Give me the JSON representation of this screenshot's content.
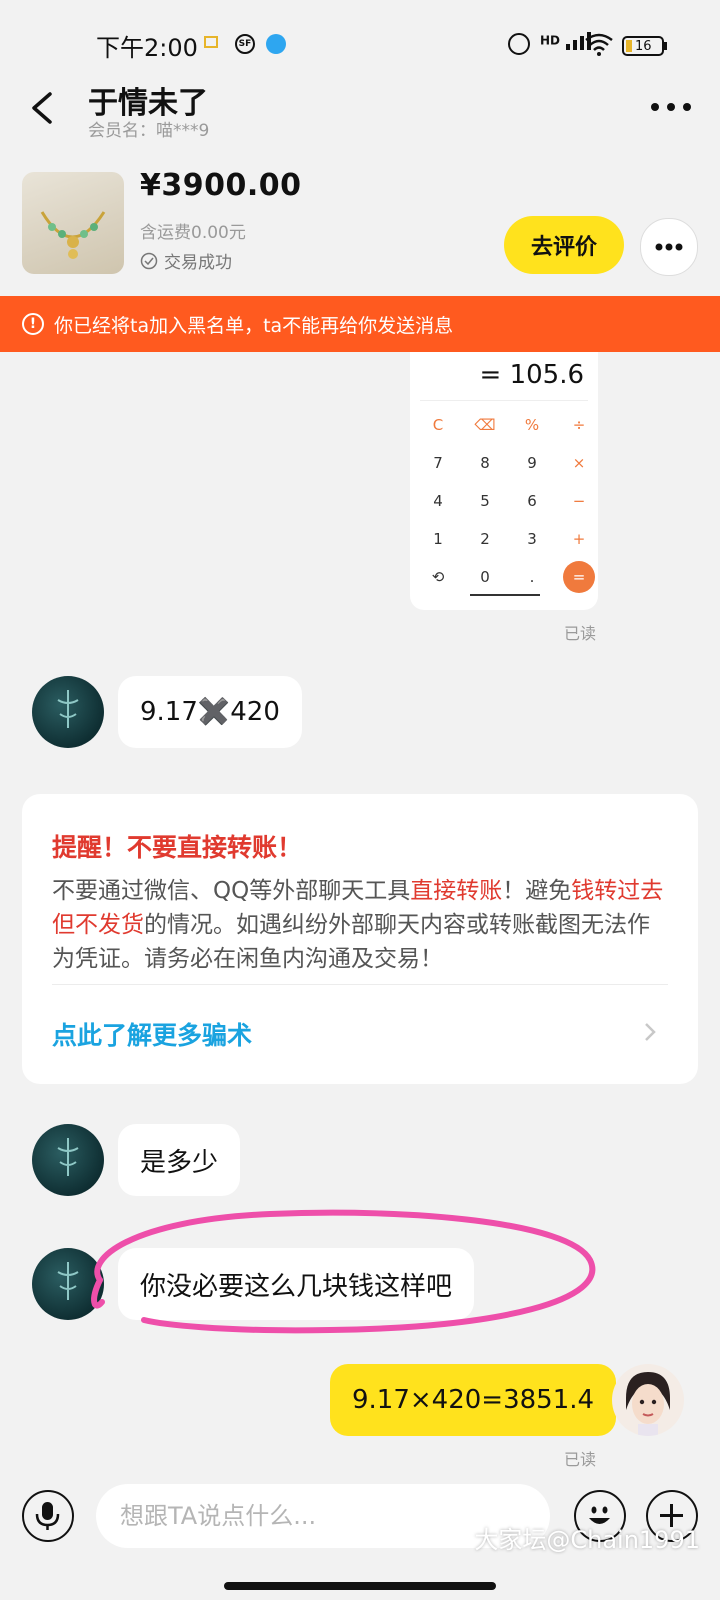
{
  "status_bar": {
    "time": "下午2:00",
    "battery": "16",
    "network": "HD"
  },
  "header": {
    "title": "于情未了",
    "member_label": "会员名：喵***9"
  },
  "product": {
    "price": "¥3900.00",
    "shipping": "含运费0.00元",
    "trade_status": "交易成功",
    "review_button": "去评价"
  },
  "banner": {
    "text": "你已经将ta加入黑名单，ta不能再给你发送消息"
  },
  "calculator": {
    "result": "= 105.6",
    "keys": [
      [
        "C",
        "⌫",
        "%",
        "÷"
      ],
      [
        "7",
        "8",
        "9",
        "×"
      ],
      [
        "4",
        "5",
        "6",
        "−"
      ],
      [
        "1",
        "2",
        "3",
        "+"
      ],
      [
        "⟲",
        "0",
        ".",
        "="
      ]
    ]
  },
  "messages": [
    {
      "side": "out",
      "type": "image",
      "read": "已读"
    },
    {
      "side": "in",
      "text": "9.17✖️420"
    },
    {
      "side": "in",
      "text": "是多少"
    },
    {
      "side": "in",
      "text": "你没必要这么几块钱这样吧"
    },
    {
      "side": "out",
      "text": "9.17×420=3851.4",
      "read": "已读"
    }
  ],
  "warning": {
    "title": "提醒！不要直接转账！",
    "body_1": "不要通过微信、QQ等外部聊天工具",
    "body_red_1": "直接转账",
    "body_2": "！避免",
    "body_red_2": "钱转过去但不发货",
    "body_3": "的情况。如遇纠纷外部聊天内容或转账截图无法作为凭证。请务必在闲鱼内沟通及交易！",
    "link": "点此了解更多骗术"
  },
  "input": {
    "placeholder": "想跟TA说点什么..."
  },
  "watermark": "大家坛@Chain1991",
  "colors": {
    "accent_yellow": "#ffe21d",
    "banner_orange": "#ff5a1f",
    "warning_red": "#e03a2f",
    "link_blue": "#1aa3e0",
    "annotation_pink": "#ee4faa"
  }
}
